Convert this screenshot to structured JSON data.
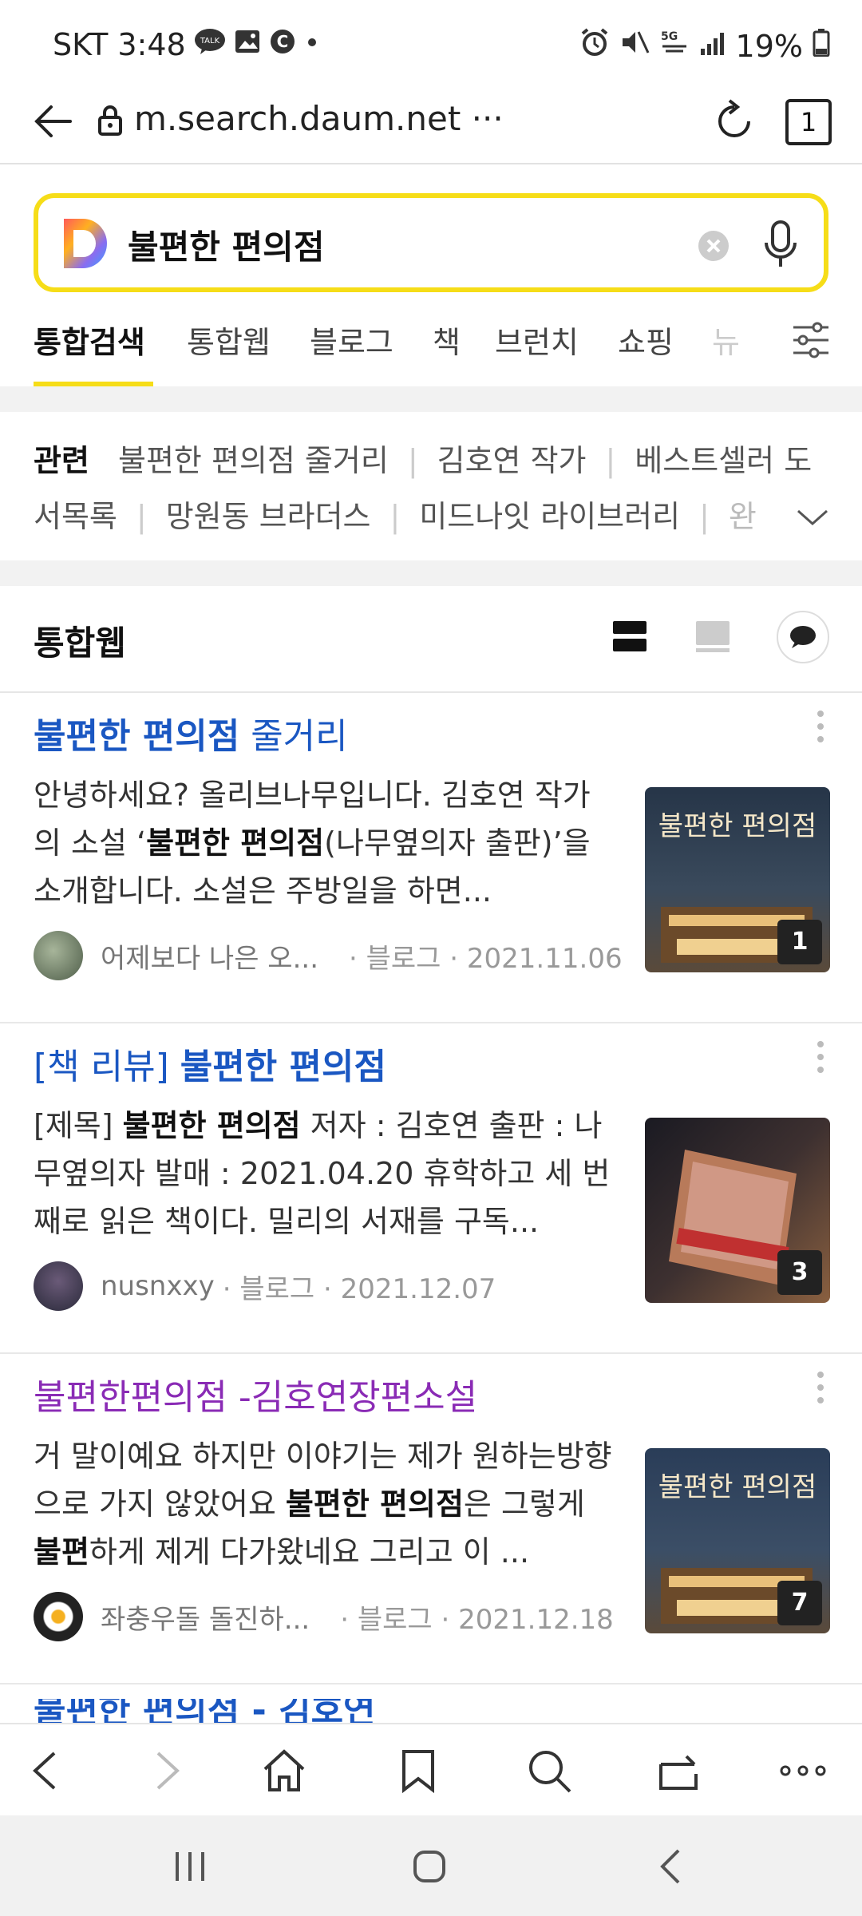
{
  "status_bar": {
    "time": "SKT 3:48",
    "talk_badge": "TALK",
    "c_badge": "C",
    "net_badge": "5G",
    "battery": "19%"
  },
  "url_bar": {
    "url": "m.search.daum.net ···",
    "tab_count": "1"
  },
  "search": {
    "logo_letter": "D",
    "query": "불편한 편의점"
  },
  "tabs": [
    "통합검색",
    "통합웹",
    "블로그",
    "책",
    "브런치",
    "쇼핑",
    "뉴"
  ],
  "related": {
    "label": "관련",
    "items_row1": [
      "불편한 편의점 줄거리",
      "김호연 작가",
      "베스트셀러 도"
    ],
    "items_row2": [
      "서목록",
      "망원동 브라더스",
      "미드나잇 라이브러리",
      "완"
    ]
  },
  "section": {
    "title": "통합웹"
  },
  "results": [
    {
      "title_html": "<b>불편한 편의점</b> 줄거리",
      "snippet_html": "안녕하세요? 올리브나무입니다. 김호연 작가의 소설 ‘<b>불편한 편의점</b>(나무옆의자 출판)’을 소개합니다. 소설은 주방일을 하면...",
      "author": "어제보다 나은 오...",
      "source": "블로그",
      "date": "2021.11.06",
      "image_count": "1",
      "thumb_text": "불편한 편의점",
      "colors": {
        "accent": "#1a57c2"
      }
    },
    {
      "title_html": "[책 리뷰] <b>불편한 편의점</b>",
      "snippet_html": "[제목] <b>불편한 편의점</b> 저자 : 김호연 출판 : 나무옆의자 발매 : 2021.04.20 휴학하고 세 번째로 읽은 책이다. 밀리의 서재를 구독...",
      "author": "nusnxxy",
      "source": "블로그",
      "date": "2021.12.07",
      "image_count": "3",
      "thumb_text": "",
      "colors": {
        "accent": "#1a57c2"
      }
    },
    {
      "title_html": "불편한편의점 -김호연장편소설",
      "snippet_html": "거 말이예요 하지만 이야기는 제가 원하는방향으로 가지 않았어요 <b>불편한 편의점</b>은 그렇게 <b>불편</b>하게 제게 다가왔네요 그리고 이 ...",
      "author": "좌충우돌 돌진하...",
      "source": "블로그",
      "date": "2021.12.18",
      "image_count": "7",
      "thumb_text": "불편한 편의점",
      "colors": {
        "accent": "#8a2bb5"
      }
    }
  ],
  "partial_next_title": "불편한 편의점 - 김호연"
}
